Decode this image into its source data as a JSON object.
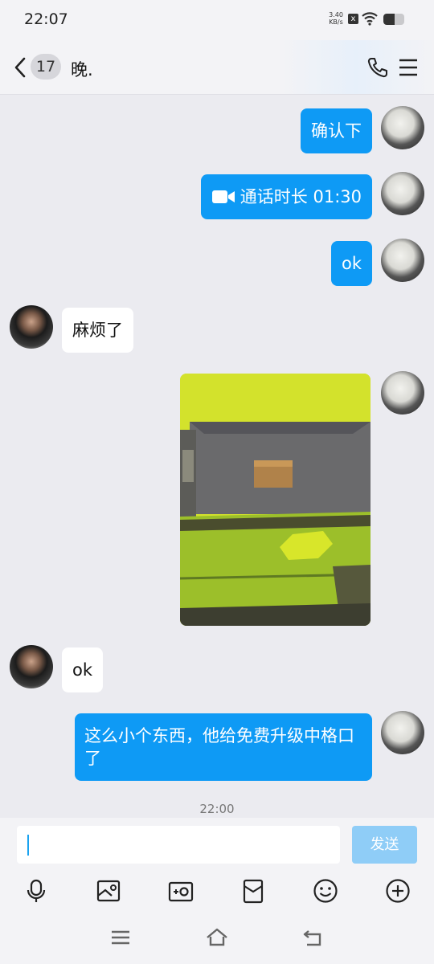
{
  "status_bar": {
    "time": "22:07",
    "net_speed_value": "3.40",
    "net_speed_unit": "KB/s",
    "x_badge": "x",
    "battery_level": 0.55
  },
  "header": {
    "back_icon": "chevron-left-icon",
    "unread_count": "17",
    "title": "晚.",
    "phone_icon": "phone-icon",
    "menu_icon": "menu-icon"
  },
  "messages": [
    {
      "side": "out",
      "type": "text",
      "text": "确认下"
    },
    {
      "side": "out",
      "type": "call",
      "text": "通话时长 01:30",
      "icon": "video-call-icon"
    },
    {
      "side": "out",
      "type": "text",
      "text": "ok"
    },
    {
      "side": "in",
      "type": "text",
      "text": "麻烦了"
    },
    {
      "side": "out",
      "type": "image",
      "description_icon": "photo"
    },
    {
      "side": "in",
      "type": "text",
      "text": "ok"
    },
    {
      "side": "out",
      "type": "text",
      "text": "这么小个东西，他给免费升级中格口了"
    }
  ],
  "timestamp": "22:00",
  "input": {
    "value": "",
    "placeholder": "",
    "send_label": "发送"
  },
  "toolbar": {
    "items": [
      "microphone-icon",
      "image-icon",
      "camera-icon",
      "red-packet-icon",
      "emoji-icon",
      "plus-icon"
    ]
  },
  "nav": {
    "items": [
      "recents-icon",
      "home-icon",
      "back-icon"
    ]
  },
  "colors": {
    "accent": "#0e9af5",
    "send_disabled": "#8fcdf7",
    "background": "#ebebf0"
  }
}
